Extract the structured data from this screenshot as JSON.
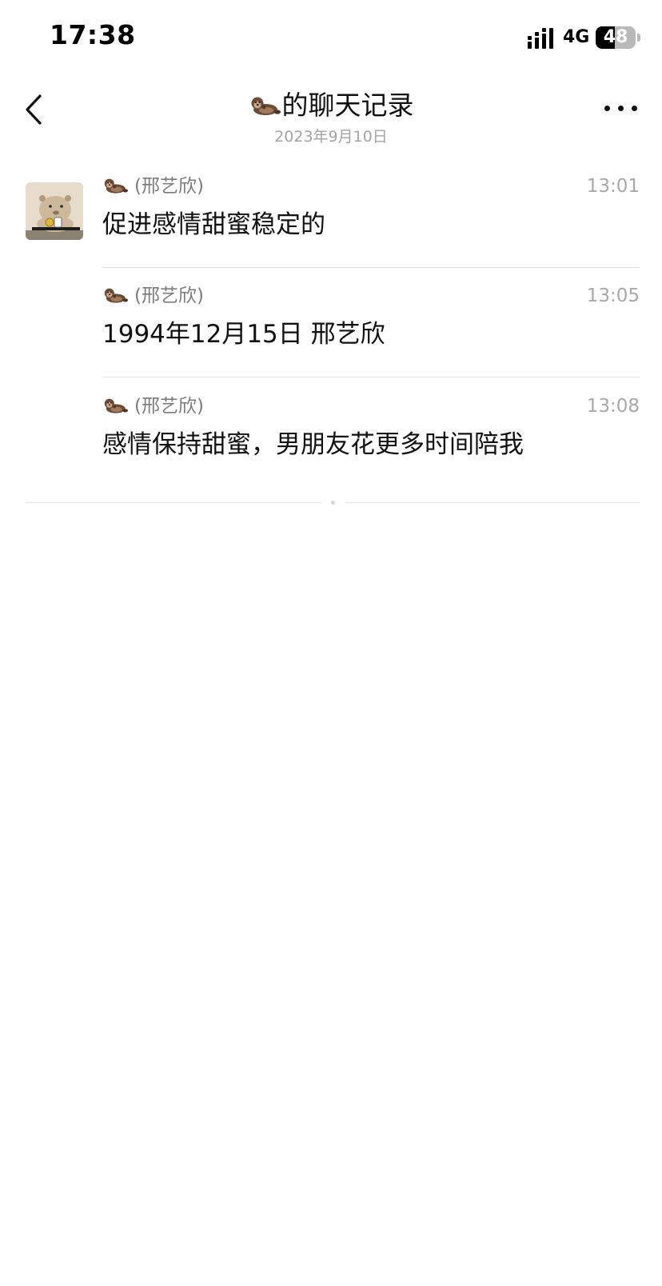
{
  "status_bar": {
    "time": "17:38",
    "network": "4G",
    "battery": "48",
    "battery_level": 0.48,
    "signal_icon": "cellular-signal-icon"
  },
  "header": {
    "back_icon": "chevron-left-icon",
    "title_emoji": "otter-emoji",
    "title": "的聊天记录",
    "subtitle": "2023年9月10日",
    "more_icon": "more-dots-icon"
  },
  "records": [
    {
      "sender": "(邢艺欣)",
      "time": "13:01",
      "text": "促进感情甜蜜稳定的"
    },
    {
      "sender": "(邢艺欣)",
      "time": "13:05",
      "text": "1994年12月15日 邢艺欣"
    },
    {
      "sender": "(邢艺欣)",
      "time": "13:08",
      "text": "感情保持甜蜜，男朋友花更多时间陪我"
    }
  ],
  "colors": {
    "text_primary": "#111111",
    "text_secondary": "#7c7c7c",
    "text_time": "#a8a8a8",
    "divider": "#e3e3e3"
  }
}
